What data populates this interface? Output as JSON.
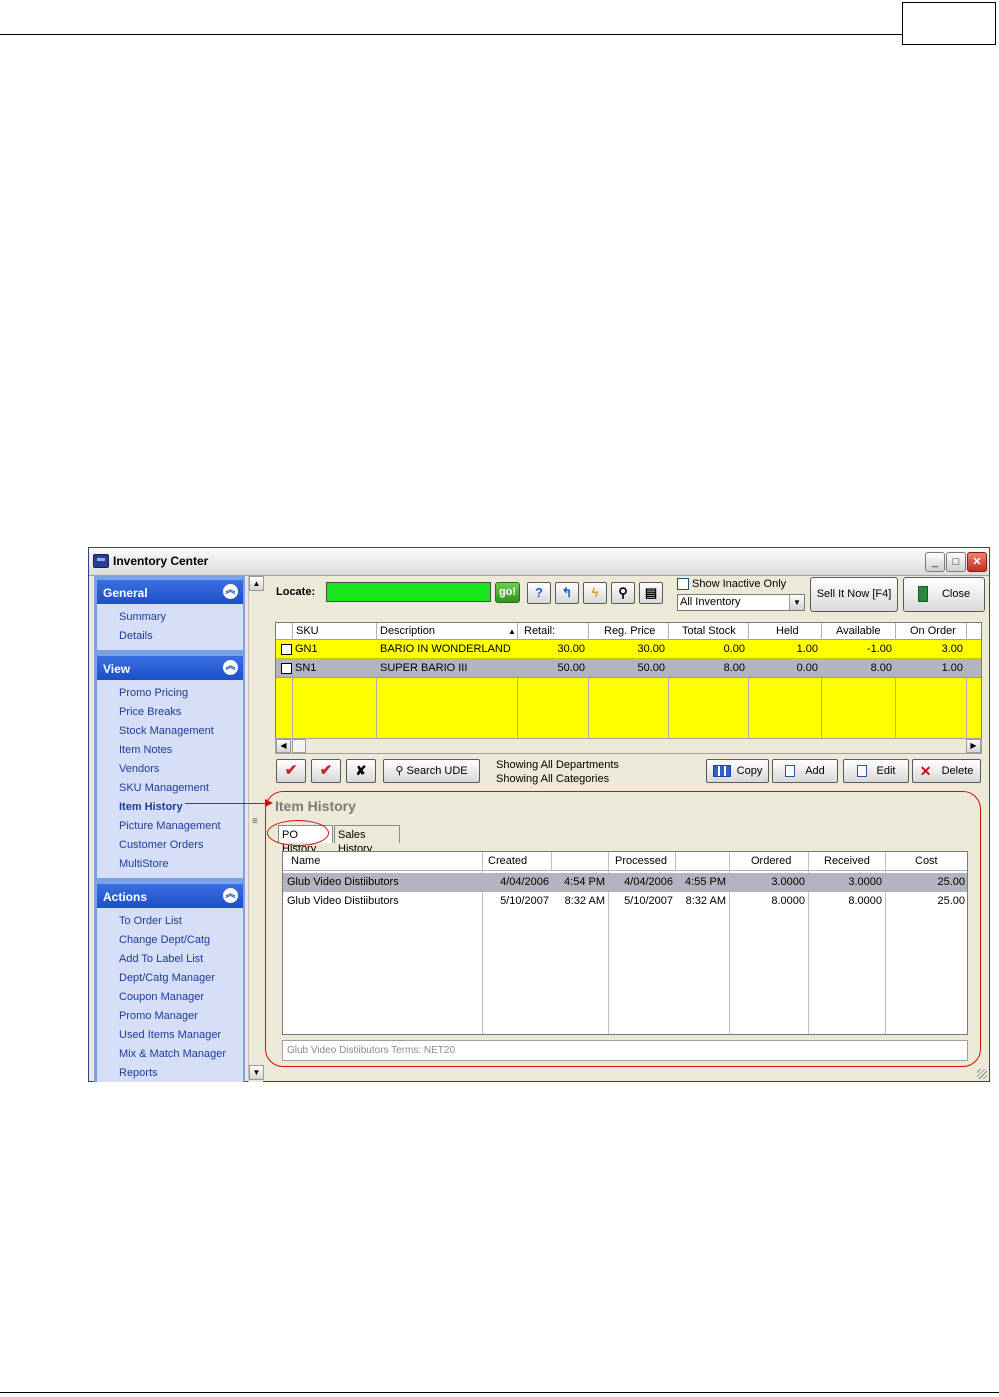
{
  "window": {
    "title": "Inventory Center"
  },
  "sidebar": {
    "general": {
      "label": "General",
      "items": [
        "Summary",
        "Details"
      ]
    },
    "view": {
      "label": "View",
      "items": [
        "Promo Pricing",
        "Price Breaks",
        "Stock Management",
        "Item Notes",
        "Vendors",
        "SKU Management",
        "Item History",
        "Picture Management",
        "Customer Orders",
        "MultiStore"
      ],
      "active": "Item History"
    },
    "actions": {
      "label": "Actions",
      "items": [
        "To Order List",
        "Change Dept/Catg",
        "Add To Label List",
        "Dept/Catg Manager",
        "Coupon Manager",
        "Promo Manager",
        "Used Items Manager",
        "Mix & Match Manager",
        "Reports"
      ]
    }
  },
  "toolbar": {
    "locate_label": "Locate:",
    "go_label": "go!",
    "show_inactive_label": "Show Inactive Only",
    "inventory_filter": "All Inventory",
    "sell_now_label": "Sell It Now [F4]",
    "close_label": "Close"
  },
  "grid": {
    "columns": [
      "SKU",
      "Description",
      "Retail:",
      "Reg. Price",
      "Total Stock",
      "Held",
      "Available",
      "On Order"
    ],
    "rows": [
      {
        "sku": "GN1",
        "description": "BARIO IN WONDERLAND",
        "retail": "30.00",
        "reg_price": "30.00",
        "total_stock": "0.00",
        "held": "1.00",
        "available": "-1.00",
        "on_order": "3.00"
      },
      {
        "sku": "SN1",
        "description": "SUPER BARIO III",
        "retail": "50.00",
        "reg_price": "50.00",
        "total_stock": "8.00",
        "held": "0.00",
        "available": "8.00",
        "on_order": "1.00"
      }
    ]
  },
  "actions_row": {
    "search_ude_label": "Search UDE",
    "filter_dept": "Showing All Departments",
    "filter_catg": "Showing All Categories",
    "copy_label": "Copy",
    "add_label": "Add",
    "edit_label": "Edit",
    "delete_label": "Delete"
  },
  "item_history": {
    "title": "Item History",
    "tabs": [
      "PO History",
      "Sales History"
    ],
    "columns": [
      "Name",
      "Created",
      "Processed",
      "Ordered",
      "Received",
      "Cost"
    ],
    "rows": [
      {
        "name": "Glub Video Distiibutors",
        "created_date": "4/04/2006",
        "created_time": "4:54 PM",
        "processed_date": "4/04/2006",
        "processed_time": "4:55 PM",
        "ordered": "3.0000",
        "received": "3.0000",
        "cost": "25.00"
      },
      {
        "name": "Glub Video Distiibutors",
        "created_date": "5/10/2007",
        "created_time": "8:32 AM",
        "processed_date": "5/10/2007",
        "processed_time": "8:32 AM",
        "ordered": "8.0000",
        "received": "8.0000",
        "cost": "25.00"
      }
    ],
    "status": "Glub Video Distiibutors  Terms: NET20"
  },
  "colors": {
    "grid_highlight": "#ffff00",
    "locate_field": "#19e619",
    "annotation": "#d01010",
    "sidebar_header": "#1d4fc8"
  }
}
